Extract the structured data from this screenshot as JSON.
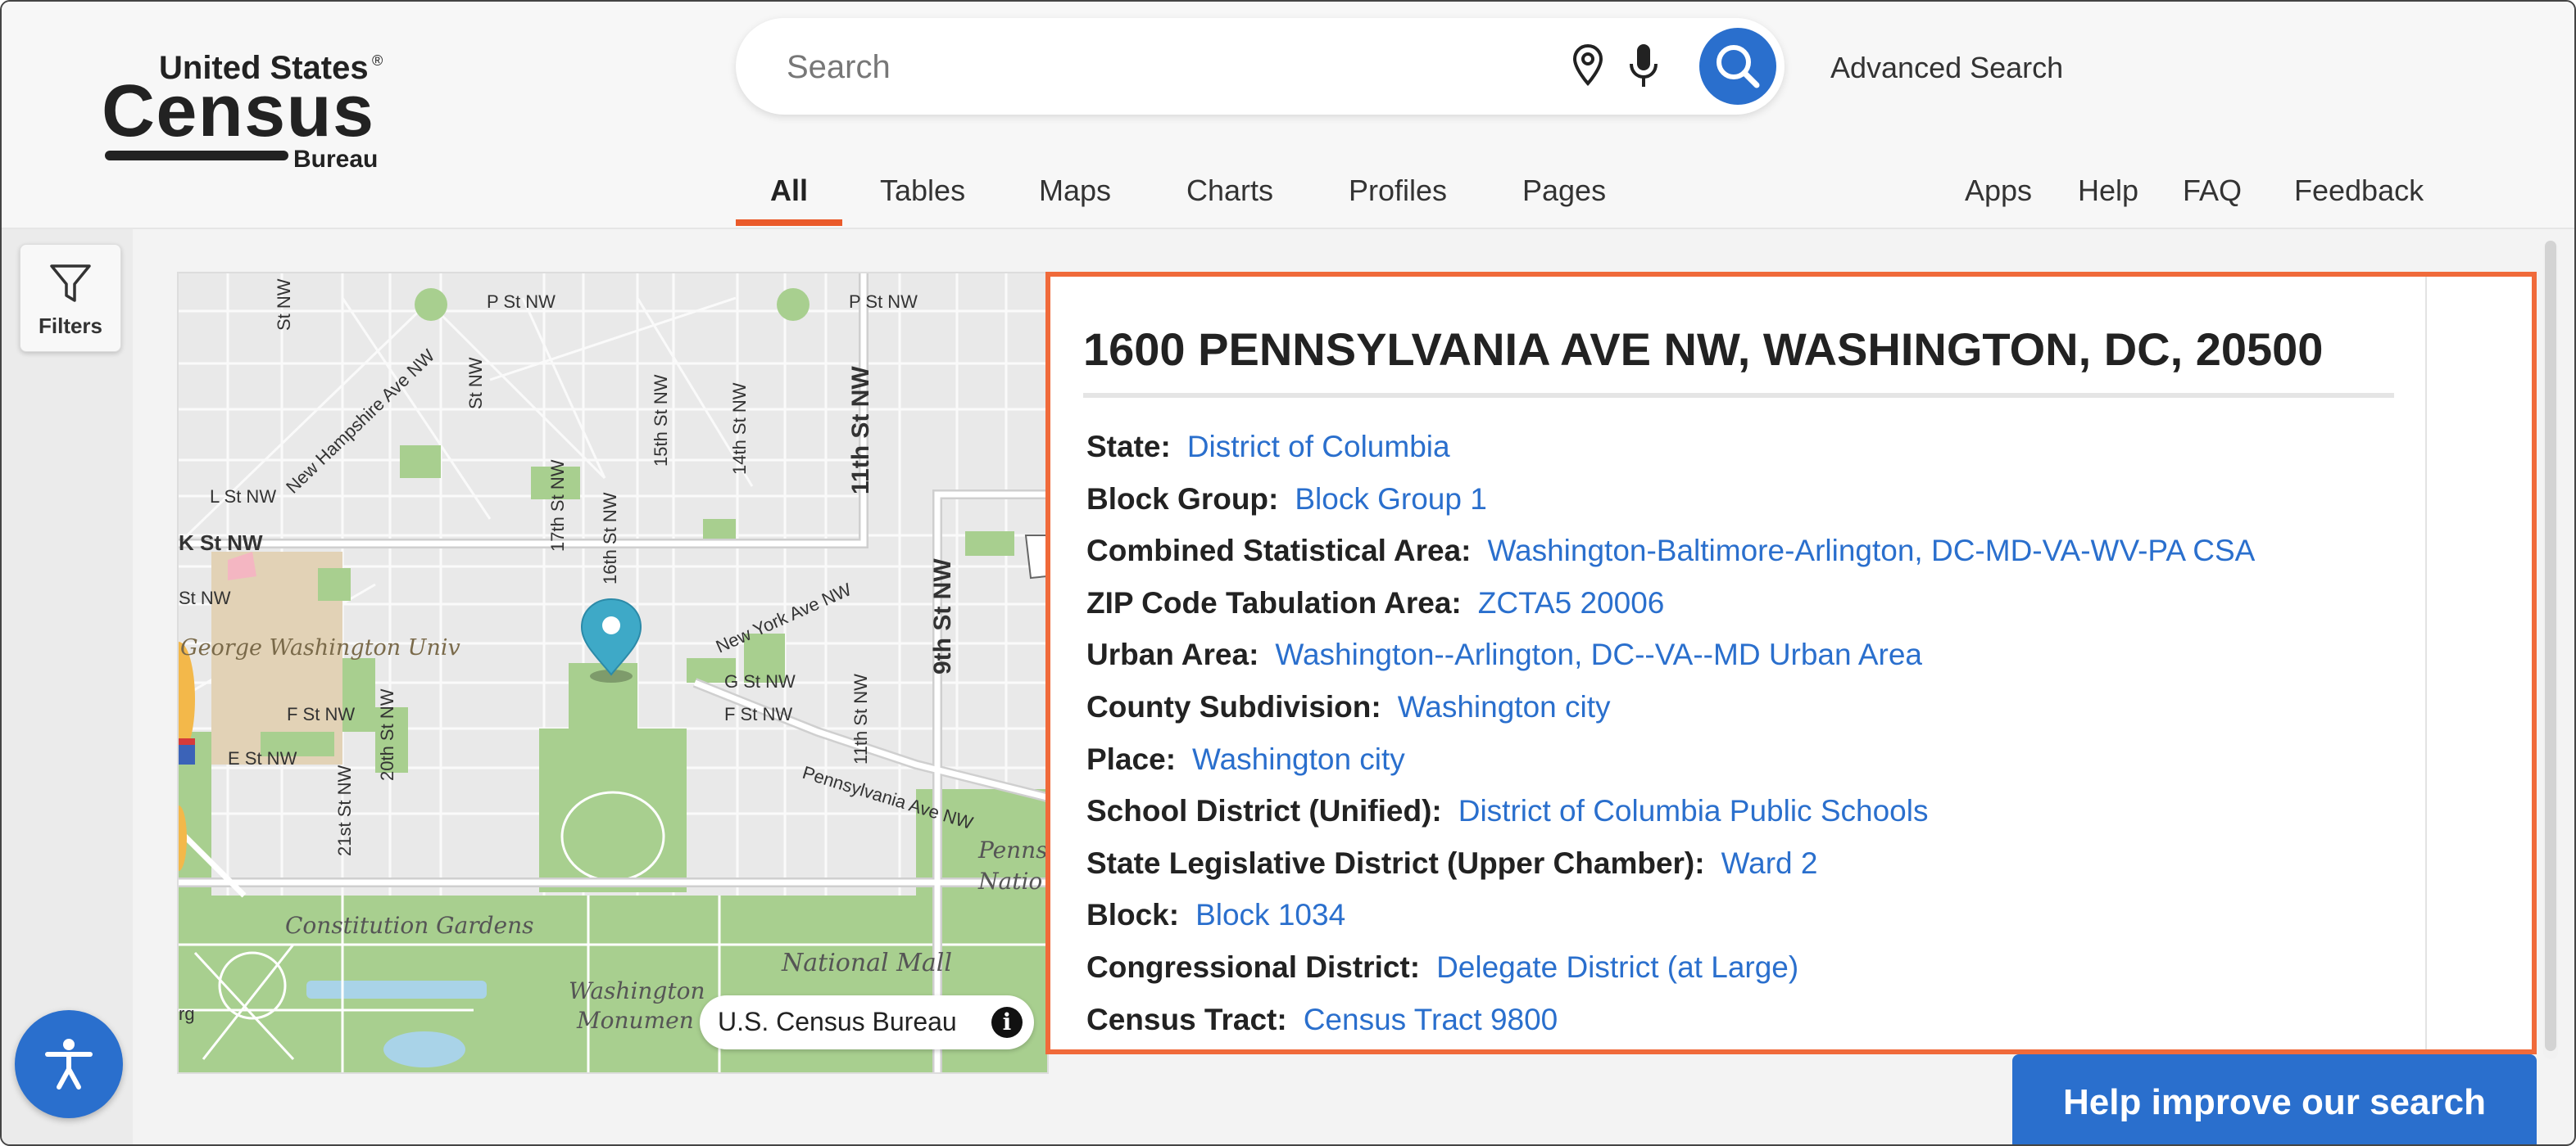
{
  "header": {
    "logo": {
      "line1": "United States",
      "line2": "Census",
      "line3": "Bureau",
      "registered": "®"
    },
    "search": {
      "placeholder": "Search",
      "value": ""
    },
    "advanced_search": "Advanced Search",
    "tabs": [
      {
        "label": "All",
        "active": true
      },
      {
        "label": "Tables",
        "active": false
      },
      {
        "label": "Maps",
        "active": false
      },
      {
        "label": "Charts",
        "active": false
      },
      {
        "label": "Profiles",
        "active": false
      },
      {
        "label": "Pages",
        "active": false
      }
    ],
    "utility_links": [
      "Apps",
      "Help",
      "FAQ",
      "Feedback"
    ]
  },
  "sidebar": {
    "filters_label": "Filters"
  },
  "map": {
    "street_labels": [
      "P St NW",
      "P St NW",
      "New Hampshire Ave NW",
      "L St NW",
      "K St NW",
      "St NW",
      "17th St NW",
      "16th St NW",
      "15th St NW",
      "14th St NW",
      "11th St NW",
      "9th St NW",
      "New York Ave NW",
      "G St NW",
      "F St NW",
      "F St NW",
      "E St NW",
      "20th St NW",
      "21st St NW",
      "11th St NW",
      "Pennsylvania Ave NW",
      "St NW",
      "St NW",
      "rg"
    ],
    "area_labels": [
      "George Washington Univ",
      "Constitution Gardens",
      "National Mall",
      "Washington",
      "Monumen",
      "Penns",
      "Natio"
    ],
    "attribution": "U.S. Census Bureau",
    "info_glyph": "i",
    "colors": {
      "base": "#e9e9e9",
      "park": "#a8cf8f",
      "road": "#ffffff",
      "campus": "#e2d2b6",
      "marker": "#3ea9c7"
    }
  },
  "result": {
    "address": "1600 PENNSYLVANIA AVE NW, WASHINGTON, DC, 20500",
    "geographies": [
      {
        "label": "State:",
        "value": "District of Columbia"
      },
      {
        "label": "Block Group:",
        "value": "Block Group 1"
      },
      {
        "label": "Combined Statistical Area:",
        "value": "Washington-Baltimore-Arlington, DC-MD-VA-WV-PA CSA"
      },
      {
        "label": "ZIP Code Tabulation Area:",
        "value": "ZCTA5 20006"
      },
      {
        "label": "Urban Area:",
        "value": "Washington--Arlington, DC--VA--MD Urban Area"
      },
      {
        "label": "County Subdivision:",
        "value": "Washington city"
      },
      {
        "label": "Place:",
        "value": "Washington city"
      },
      {
        "label": "School District (Unified):",
        "value": "District of Columbia Public Schools"
      },
      {
        "label": "State Legislative District (Upper Chamber):",
        "value": "Ward 2"
      },
      {
        "label": "Block:",
        "value": "Block 1034"
      },
      {
        "label": "Congressional District:",
        "value": "Delegate District (at Large)"
      },
      {
        "label": "Census Tract:",
        "value": "Census Tract 9800"
      }
    ]
  },
  "help_button": "Help improve our search",
  "colors": {
    "accent": "#2a6fcd",
    "highlight": "#f06a3a",
    "tab_underline": "#ea5a2a"
  }
}
